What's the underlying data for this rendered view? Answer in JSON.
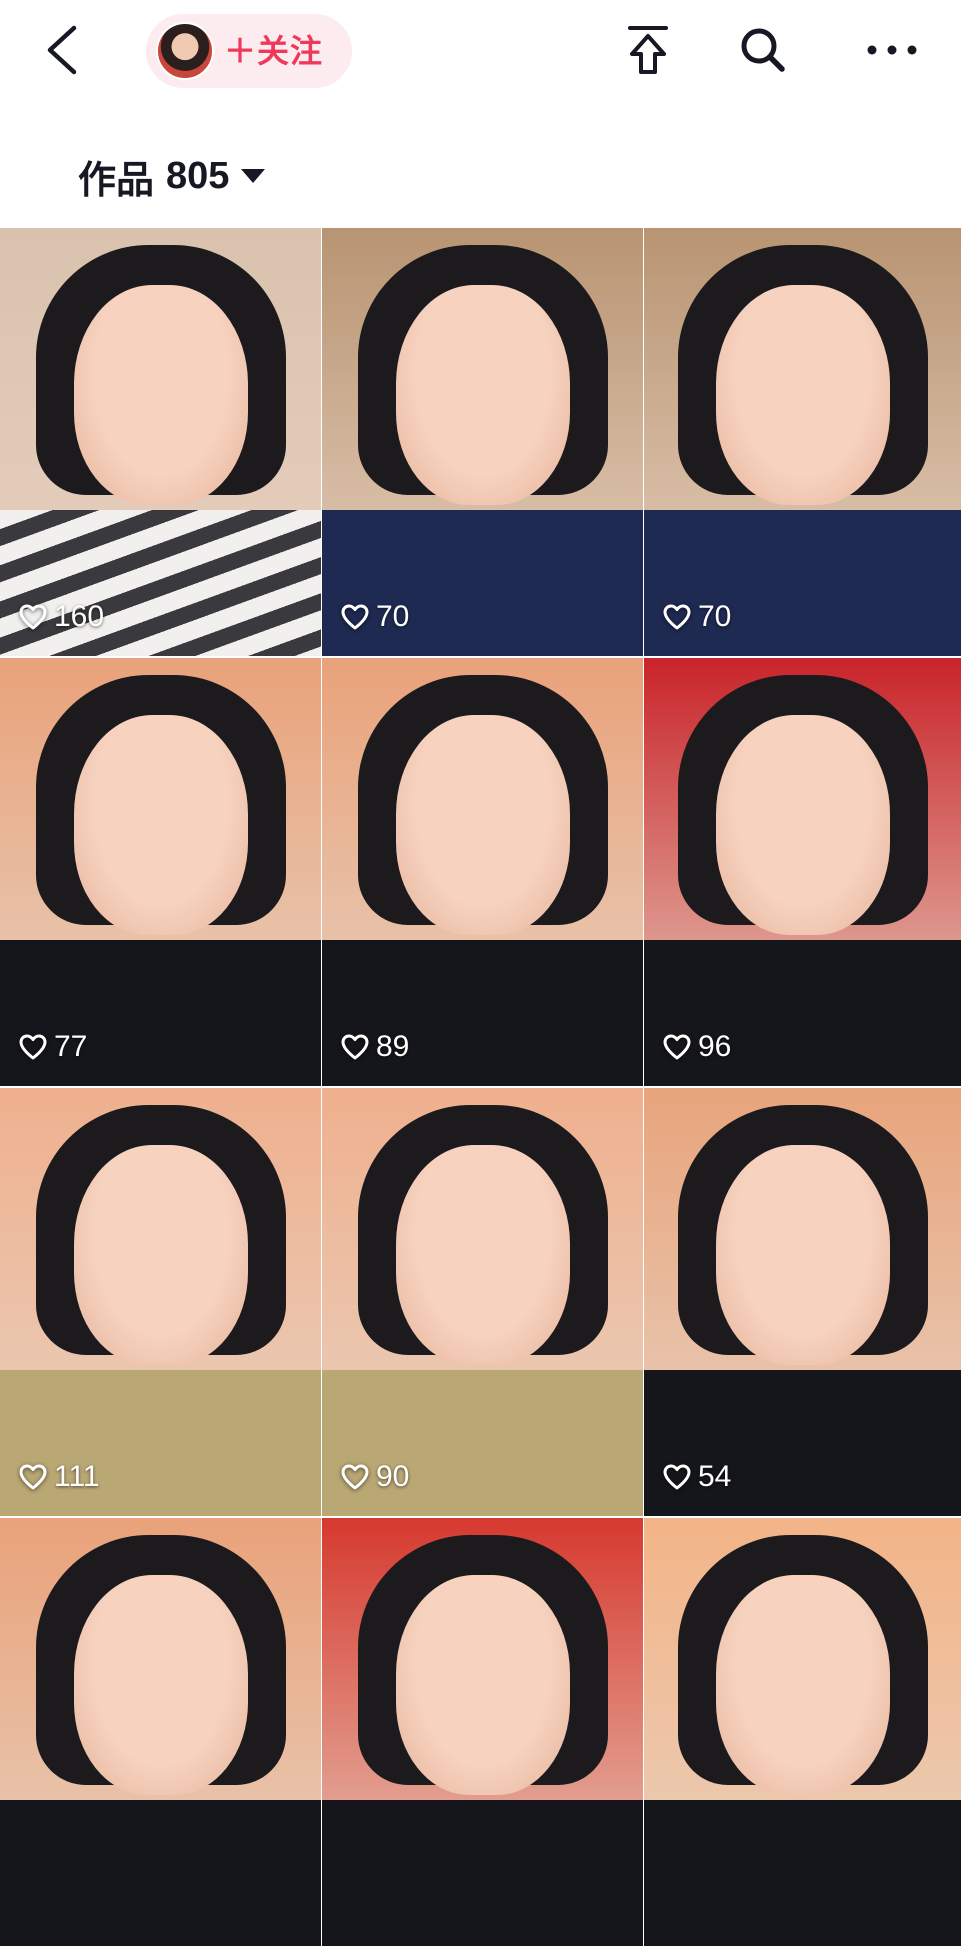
{
  "header": {
    "follow_label": "＋关注"
  },
  "works": {
    "label": "作品",
    "count": "805"
  },
  "grid": {
    "items": [
      {
        "likes": "160",
        "bg": "#d9c2ad",
        "shirt": "stripe"
      },
      {
        "likes": "70",
        "bg": "#b89472",
        "shirt": "#1f2a52"
      },
      {
        "likes": "70",
        "bg": "#b89472",
        "shirt": "#1f2a52"
      },
      {
        "likes": "77",
        "bg": "#e9a27a",
        "shirt": "#15161b"
      },
      {
        "likes": "89",
        "bg": "#e9a27a",
        "shirt": "#15161b"
      },
      {
        "likes": "96",
        "bg": "#c9242a",
        "shirt": "#15161b"
      },
      {
        "likes": "111",
        "bg": "#efb08e",
        "shirt": "#b9a774"
      },
      {
        "likes": "90",
        "bg": "#efb08e",
        "shirt": "#b9a774"
      },
      {
        "likes": "54",
        "bg": "#e8a47c",
        "shirt": "#15161b"
      },
      {
        "likes": "",
        "bg": "#e9a27a",
        "shirt": "#15161b"
      },
      {
        "likes": "",
        "bg": "#d6392f",
        "shirt": "#15161b"
      },
      {
        "likes": "",
        "bg": "#f3b487",
        "shirt": "#15161b"
      }
    ]
  }
}
